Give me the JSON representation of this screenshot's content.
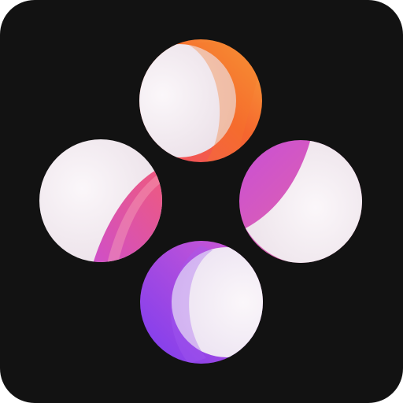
{
  "app_icon": {
    "icon_name": "four-orbs-app-icon",
    "background_color": "#121212",
    "orbs": [
      {
        "name": "orb-top",
        "position": "top",
        "base_color": "#f0e6ee",
        "accent_colors": [
          "#f04a6e",
          "#f7772a",
          "#f7a23a"
        ]
      },
      {
        "name": "orb-left",
        "position": "left",
        "base_color": "#f2e8ef",
        "accent_colors": [
          "#f05a7a",
          "#cf4fc9"
        ]
      },
      {
        "name": "orb-right",
        "position": "right",
        "base_color": "#f2e8ef",
        "accent_colors": [
          "#c94fd6",
          "#e86a9a"
        ]
      },
      {
        "name": "orb-bottom",
        "position": "bottom",
        "base_color": "#f0e6f2",
        "accent_colors": [
          "#7b3cf0",
          "#c452d8"
        ]
      }
    ]
  }
}
